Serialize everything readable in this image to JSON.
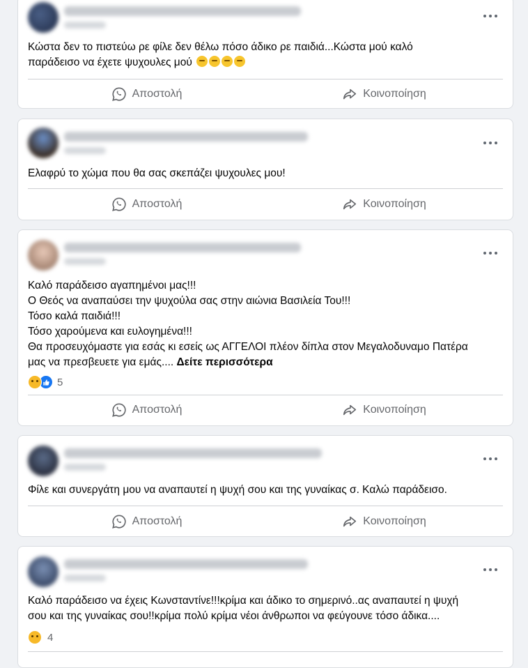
{
  "actions": {
    "send_label": "Αποστολή",
    "share_label": "Κοινοποίηση"
  },
  "posts": [
    {
      "text_line1": "Κώστα δεν το πιστεύω ρε φίλε δεν θέλω  πόσο άδικο ρε παιδιά...Κώστα μού καλό",
      "text_line2": "παράδεισο να έχετε ψυχουλες μού",
      "emoji": "sleepy-face-emoji"
    },
    {
      "text": "Ελαφρύ το χώμα που θα σας σκεπάζει ψυχουλες μου!"
    },
    {
      "text": "Καλό παράδεισο αγαπημένοι μας!!!\nΟ Θεός να αναπαύσει την ψυχούλα σας στην αιώνια Βασιλεία Του!!!\nΤόσο καλά παιδιά!!!\nΤόσο χαρούμενα και ευλογημένα!!!\nΘα προσευχόμαστε για εσάς κι εσείς ως ΑΓΓΕΛΟΙ πλέον δίπλα στον Μεγαλοδυναμο Πατέρα\nμας να πρεσβευετε για εμάς.... ",
      "see_more": "Δείτε περισσότερα",
      "reaction_count": "5"
    },
    {
      "text": "Φίλε και συνεργάτη μου να αναπαυτεί η ψυχή σου και της γυναίκας σ. Καλώ παράδεισο."
    },
    {
      "text": "Καλό παράδεισο να έχεις Κωνσταντίνε!!!κρίμα και άδικο το σημερινό..ας αναπαυτεί η ψυχή\nσου και της γυναίκας σου!!κρίμα πολύ κρίμα νέοι άνθρωποι να φεύγουνε τόσο άδικα....",
      "reaction_count": "4"
    }
  ],
  "colors": {
    "background": "#f0f2f5",
    "card": "#ffffff",
    "muted_text": "#65676b",
    "like_blue": "#1877f2",
    "sad_yellow": "#f7b928"
  }
}
